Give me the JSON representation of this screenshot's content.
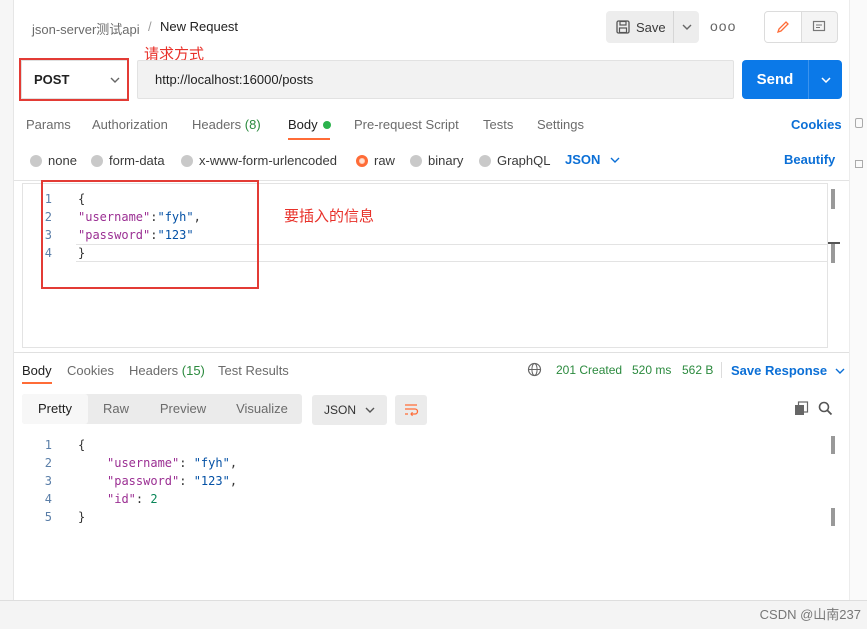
{
  "header": {
    "collection": "json-server测试api",
    "separator": "/",
    "request_name": "New Request",
    "save_label": "Save",
    "more_label": "ooo"
  },
  "request": {
    "method": "POST",
    "url": "http://localhost:16000/posts",
    "send_label": "Send"
  },
  "annotations": {
    "method_note": "请求方式",
    "body_note": "要插入的信息"
  },
  "request_tabs": {
    "params": "Params",
    "authorization": "Authorization",
    "headers": "Headers",
    "headers_count": "(8)",
    "body": "Body",
    "pre_request": "Pre-request Script",
    "tests": "Tests",
    "settings": "Settings",
    "cookies": "Cookies"
  },
  "body_types": {
    "none": "none",
    "form_data": "form-data",
    "urlencoded": "x-www-form-urlencoded",
    "raw": "raw",
    "binary": "binary",
    "graphql": "GraphQL",
    "format": "JSON",
    "beautify": "Beautify",
    "selected": "raw"
  },
  "request_body": {
    "line_numbers": [
      "1",
      "2",
      "3",
      "4"
    ],
    "l1": "{",
    "l2_key": "\"username\"",
    "l2_colon": ":",
    "l2_val": "\"fyh\"",
    "l2_comma": ",",
    "l3_key": "\"password\"",
    "l3_colon": ":",
    "l3_val": "\"123\"",
    "l4": "}"
  },
  "response_tabs": {
    "body": "Body",
    "cookies": "Cookies",
    "headers": "Headers",
    "headers_count": "(15)",
    "test_results": "Test Results"
  },
  "response_status": {
    "status": "201 Created",
    "time": "520 ms",
    "size": "562 B",
    "save_response": "Save Response"
  },
  "response_view": {
    "pretty": "Pretty",
    "raw": "Raw",
    "preview": "Preview",
    "visualize": "Visualize",
    "format": "JSON"
  },
  "response_body": {
    "line_numbers": [
      "1",
      "2",
      "3",
      "4",
      "5"
    ],
    "l1": "{",
    "l2_key": "\"username\"",
    "l2_sep": ": ",
    "l2_val": "\"fyh\"",
    "l2_comma": ",",
    "l3_key": "\"password\"",
    "l3_sep": ": ",
    "l3_val": "\"123\"",
    "l3_comma": ",",
    "l4_key": "\"id\"",
    "l4_sep": ": ",
    "l4_val": "2",
    "l5": "}"
  },
  "watermark": "CSDN @山南237",
  "colors": {
    "accent": "#ff6c37",
    "send_blue": "#0b79e8",
    "link_blue": "#0b6fd6",
    "status_green": "#2b8a3e",
    "annotation_red": "#e33b35"
  }
}
